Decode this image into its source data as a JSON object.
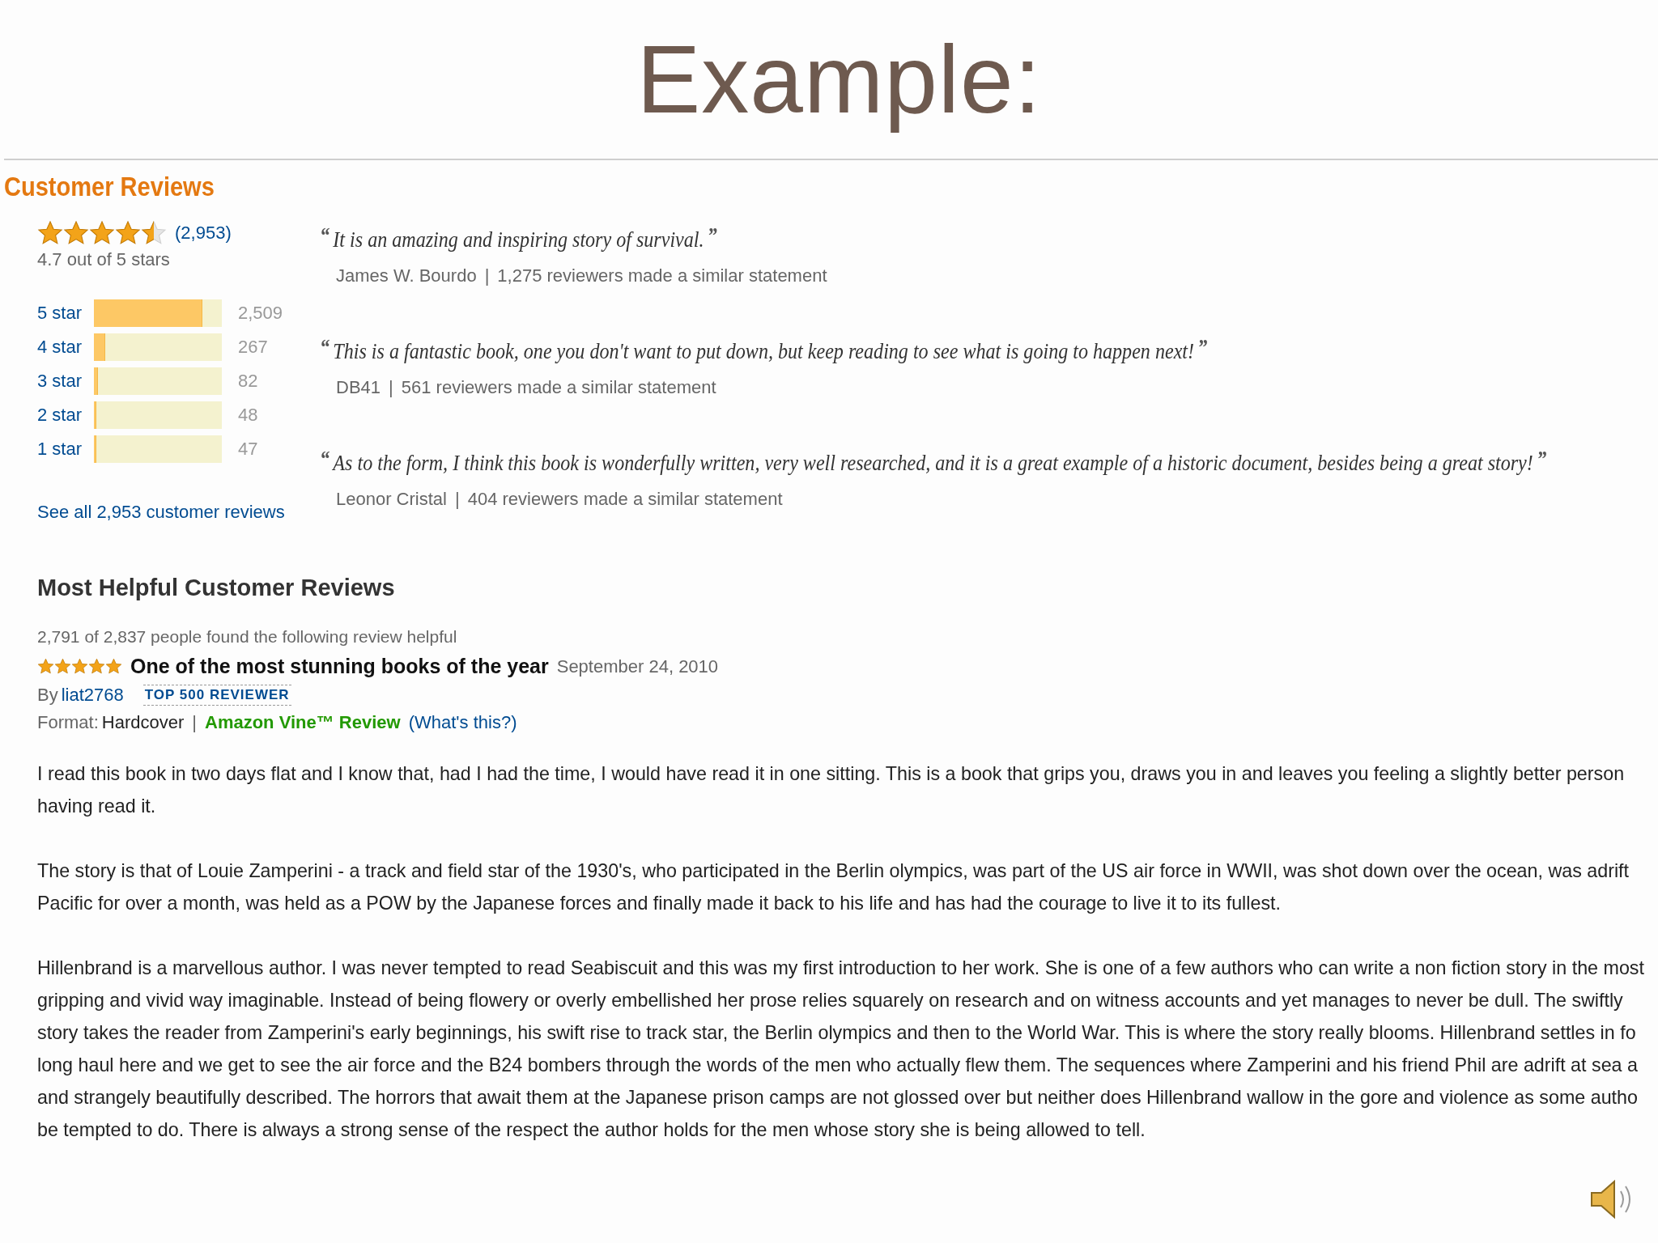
{
  "slide_title": "Example:",
  "customer_reviews": {
    "heading": "Customer Reviews",
    "rating": {
      "stars": 4.5,
      "count": "(2,953)",
      "summary": "4.7 out of 5 stars"
    },
    "histogram": [
      {
        "label": "5 star",
        "level": 0.85,
        "count": "2,509"
      },
      {
        "label": "4 star",
        "level": 0.09,
        "count": "267"
      },
      {
        "label": "3 star",
        "level": 0.03,
        "count": "82"
      },
      {
        "label": "2 star",
        "level": 0.02,
        "count": "48"
      },
      {
        "label": "1 star",
        "level": 0.02,
        "count": "47"
      }
    ],
    "see_all": "See all 2,953 customer reviews",
    "quotes": [
      {
        "open": "“",
        "text": "It is an amazing and inspiring story of survival.",
        "close": "”",
        "author": "James W. Bourdo",
        "separator": "|",
        "statement": "1,275 reviewers made a similar statement"
      },
      {
        "open": "“",
        "text": "This is a fantastic book, one you don't want to put down, but keep reading to see what is going to happen next!",
        "close": "”",
        "author": "DB41",
        "separator": "|",
        "statement": "561 reviewers made a similar statement"
      },
      {
        "open": "“",
        "text": "As to the form, I think this book is wonderfully written, very well researched, and it is a great example of a historic document, besides being a great story!",
        "close": "”",
        "author": "Leonor Cristal",
        "separator": "|",
        "statement": "404 reviewers made a similar statement"
      }
    ]
  },
  "most_helpful": {
    "heading": "Most Helpful Customer Reviews",
    "review": {
      "helpful": "2,791 of 2,837 people found the following review helpful",
      "stars": 5,
      "title": "One of the most stunning books of the year",
      "date": "September 24, 2010",
      "by": "By",
      "author": "liat2768",
      "badge": "TOP 500 REVIEWER",
      "format_label": "Format:",
      "format": "Hardcover",
      "separator": "|",
      "vine": "Amazon Vine™ Review",
      "whats_this": "(What's this?)",
      "paragraphs": [
        [
          "I read this book in two days flat and I know that, had I had the time, I would have read it in one sitting. This is a book that grips you, draws you in and leaves you feeling a slightly better person",
          "having read it."
        ],
        [
          "The story is that of Louie Zamperini - a track and field star of the 1930's, who participated in the Berlin olympics, was part of the US air force in WWII, was shot down over the ocean, was adrift",
          "Pacific for over a month, was held as a POW by the Japanese forces and finally made it back to his life and has had the courage to live it to its fullest."
        ],
        [
          "Hillenbrand is a marvellous author. I was never tempted to read Seabiscuit and this was my first introduction to her work. She is one of a few authors who can write a non fiction story in the most",
          "gripping and vivid way imaginable. Instead of being flowery or overly embellished her prose relies squarely on research and on witness accounts and yet manages to never be dull. The swiftly",
          "story takes the reader from Zamperini's early beginnings, his swift rise to track star, the Berlin olympics and then to the World War. This is where the story really blooms. Hillenbrand settles in fo",
          "long haul here and we get to see the air force and the B24 bombers through the words of the men who actually flew them. The sequences where Zamperini and his friend Phil are adrift at sea a",
          "and strangely beautifully described. The horrors that await them at the Japanese prison camps are not glossed over but neither does Hillenbrand wallow in the gore and violence as some autho",
          "be tempted to do. There is always a strong sense of the respect the author holds for the men whose story she is being allowed to tell."
        ]
      ]
    }
  }
}
